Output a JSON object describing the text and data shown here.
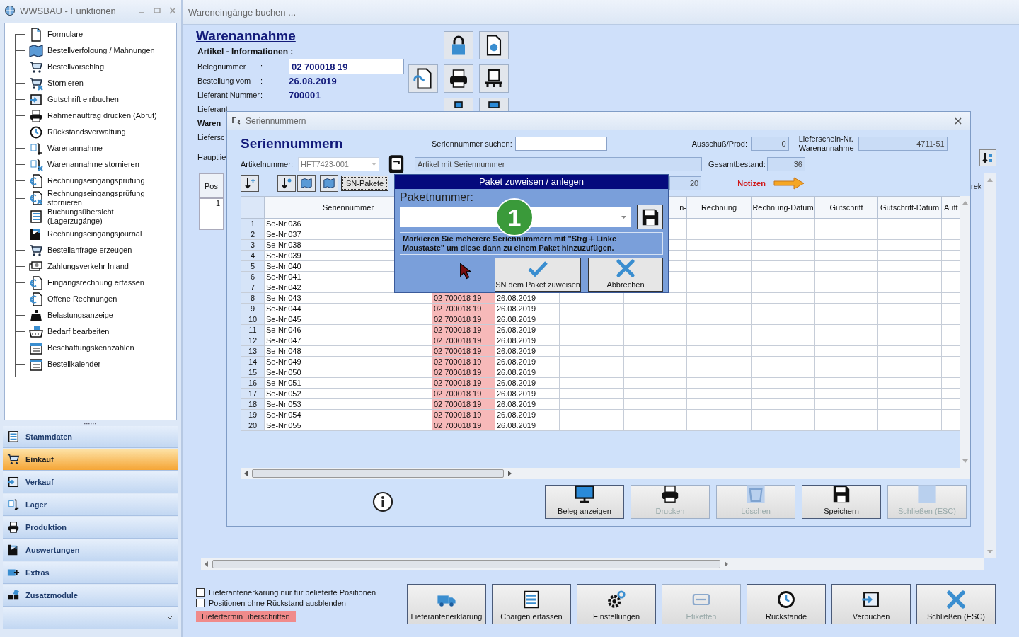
{
  "sidebar": {
    "title": "WWSBAU - Funktionen",
    "items": [
      {
        "label": "Formulare"
      },
      {
        "label": "Bestellverfolgung / Mahnungen"
      },
      {
        "label": "Bestellvorschlag"
      },
      {
        "label": "Stornieren"
      },
      {
        "label": "Gutschrift einbuchen"
      },
      {
        "label": "Rahmenauftrag drucken (Abruf)"
      },
      {
        "label": "Rückstandsverwaltung"
      },
      {
        "label": "Warenannahme"
      },
      {
        "label": "Warenannahme stornieren"
      },
      {
        "label": "Rechnungseingangsprüfung"
      },
      {
        "label": "Rechnungseingangsprüfung stornieren"
      },
      {
        "label": "Buchungsübersicht (Lagerzugänge)"
      },
      {
        "label": "Rechnungseingangsjournal"
      },
      {
        "label": "Bestellanfrage erzeugen"
      },
      {
        "label": "Zahlungsverkehr Inland"
      },
      {
        "label": "Eingangsrechnung erfassen"
      },
      {
        "label": "Offene Rechnungen"
      },
      {
        "label": "Belastungsanzeige"
      },
      {
        "label": "Bedarf bearbeiten"
      },
      {
        "label": "Beschaffungskennzahlen"
      },
      {
        "label": "Bestellkalender"
      }
    ],
    "groups": [
      {
        "label": "Stammdaten",
        "selected": false
      },
      {
        "label": "Einkauf",
        "selected": true
      },
      {
        "label": "Verkauf",
        "selected": false
      },
      {
        "label": "Lager",
        "selected": false
      },
      {
        "label": "Produktion",
        "selected": false
      },
      {
        "label": "Auswertungen",
        "selected": false
      },
      {
        "label": "Extras",
        "selected": false
      },
      {
        "label": "Zusatzmodule",
        "selected": false
      }
    ]
  },
  "main": {
    "title": "Wareneingänge buchen ...",
    "heading": "Warenannahme",
    "subheading": "Artikel - Informationen :",
    "fields": [
      {
        "label": "Belegnummer",
        "sep": ":",
        "value": "02 700018 19",
        "kind": "input"
      },
      {
        "label": "Bestellung vom",
        "sep": ":",
        "value": "26.08.2019",
        "kind": "text"
      },
      {
        "label": "Lieferant Nummer",
        "sep": ":",
        "value": "700001",
        "kind": "text"
      },
      {
        "label": "Lieferant",
        "kind": "cut"
      }
    ],
    "cut_labels": [
      {
        "label": "Waren",
        "bold": true
      },
      {
        "label": "Liefersc",
        "bold": false
      },
      {
        "label": "Hauptlie",
        "bold": false
      }
    ],
    "grid": {
      "pos_header": "Pos",
      "first_row": "1",
      "column_cut": "rek"
    },
    "checkboxes": [
      {
        "label": "Lieferantenerkärung nur für belieferte Positionen",
        "checked": false
      },
      {
        "label": "Positionen ohne Rückstand ausblenden",
        "checked": false
      }
    ],
    "warning": "Liefertermin überschritten",
    "buttons": [
      {
        "label": "Lieferantenerklärung",
        "disabled": false
      },
      {
        "label": "Chargen erfassen",
        "disabled": false
      },
      {
        "label": "Einstellungen",
        "disabled": false
      },
      {
        "label": "Etiketten",
        "disabled": true
      },
      {
        "label": "Rückstände",
        "disabled": false
      },
      {
        "label": "Verbuchen",
        "disabled": false
      },
      {
        "label": "Schließen (ESC)",
        "disabled": false
      }
    ]
  },
  "dialog": {
    "title": "Seriennummern",
    "heading": "Seriennummern",
    "search": {
      "label": "Seriennummer suchen:"
    },
    "article": {
      "label": "Artikelnummer:",
      "value": "HFT7423-001"
    },
    "article_type": "Artikel mit Seriennummer",
    "scrap": {
      "label": "Ausschuß/Prod:",
      "value": "0"
    },
    "stock": {
      "label": "Gesamtbestand:",
      "value": "36"
    },
    "delivery": {
      "label": "Lieferschein-Nr. Warenannahme",
      "value": "4711-51"
    },
    "count": "20",
    "notes": "Notizen",
    "packages_button": "SN-Pakete",
    "columns": [
      {
        "label": "Seriennummer"
      },
      {},
      {},
      {},
      {
        "label": "n-"
      },
      {
        "label": "Rechnung"
      },
      {
        "label": "Rechnung-Datum"
      },
      {
        "label": "Gutschrift"
      },
      {
        "label": "Gutschrift-Datum"
      },
      {
        "label": "Auft"
      }
    ],
    "rows": [
      {
        "number": "1",
        "serial": "Se-Nr.036",
        "selected": true
      },
      {
        "number": "2",
        "serial": "Se-Nr.037",
        "selected": false
      },
      {
        "number": "3",
        "serial": "Se-Nr.038",
        "selected": false
      },
      {
        "number": "4",
        "serial": "Se-Nr.039",
        "selected": false
      },
      {
        "number": "5",
        "serial": "Se-Nr.040",
        "selected": false
      },
      {
        "number": "6",
        "serial": "Se-Nr.041",
        "selected": false
      },
      {
        "number": "7",
        "serial": "Se-Nr.042",
        "selected": false
      },
      {
        "number": "8",
        "serial": "Se-Nr.043",
        "selected": false,
        "beleg": "02 700018 19",
        "date": "26.08.2019",
        "overdue": true
      },
      {
        "number": "9",
        "serial": "Se-Nr.044",
        "selected": false,
        "beleg": "02 700018 19",
        "date": "26.08.2019",
        "overdue": true
      },
      {
        "number": "10",
        "serial": "Se-Nr.045",
        "selected": false,
        "beleg": "02 700018 19",
        "date": "26.08.2019",
        "overdue": true
      },
      {
        "number": "11",
        "serial": "Se-Nr.046",
        "selected": false,
        "beleg": "02 700018 19",
        "date": "26.08.2019",
        "overdue": true
      },
      {
        "number": "12",
        "serial": "Se-Nr.047",
        "selected": false,
        "beleg": "02 700018 19",
        "date": "26.08.2019",
        "overdue": true
      },
      {
        "number": "13",
        "serial": "Se-Nr.048",
        "selected": false,
        "beleg": "02 700018 19",
        "date": "26.08.2019",
        "overdue": true
      },
      {
        "number": "14",
        "serial": "Se-Nr.049",
        "selected": false,
        "beleg": "02 700018 19",
        "date": "26.08.2019",
        "overdue": true
      },
      {
        "number": "15",
        "serial": "Se-Nr.050",
        "selected": false,
        "beleg": "02 700018 19",
        "date": "26.08.2019",
        "overdue": true
      },
      {
        "number": "16",
        "serial": "Se-Nr.051",
        "selected": false,
        "beleg": "02 700018 19",
        "date": "26.08.2019",
        "overdue": true
      },
      {
        "number": "17",
        "serial": "Se-Nr.052",
        "selected": false,
        "beleg": "02 700018 19",
        "date": "26.08.2019",
        "overdue": true
      },
      {
        "number": "18",
        "serial": "Se-Nr.053",
        "selected": false,
        "beleg": "02 700018 19",
        "date": "26.08.2019",
        "overdue": true
      },
      {
        "number": "19",
        "serial": "Se-Nr.054",
        "selected": false,
        "beleg": "02 700018 19",
        "date": "26.08.2019",
        "overdue": true
      },
      {
        "number": "20",
        "serial": "Se-Nr.055",
        "selected": false,
        "beleg": "02 700018 19",
        "date": "26.08.2019",
        "overdue": true
      }
    ],
    "buttons": [
      {
        "label": "Beleg anzeigen",
        "disabled": false
      },
      {
        "label": "Drucken",
        "disabled": true
      },
      {
        "label": "Löschen",
        "disabled": true
      },
      {
        "label": "Speichern",
        "disabled": false
      },
      {
        "label": "Schließen (ESC)",
        "disabled": true
      }
    ]
  },
  "popup": {
    "title": "Paket zuweisen / anlegen",
    "field_label": "Paketnummer:",
    "hint": "Markieren Sie meherere Seriennummern mit \"Strg + Linke Maustaste\" um diese dann zu einem Paket hinzuzufügen.",
    "buttons": [
      {
        "label": "SN dem Paket zuweisen",
        "kind": "confirm"
      },
      {
        "label": "Abbrechen",
        "kind": "cancel"
      }
    ],
    "step_badge": "1"
  }
}
